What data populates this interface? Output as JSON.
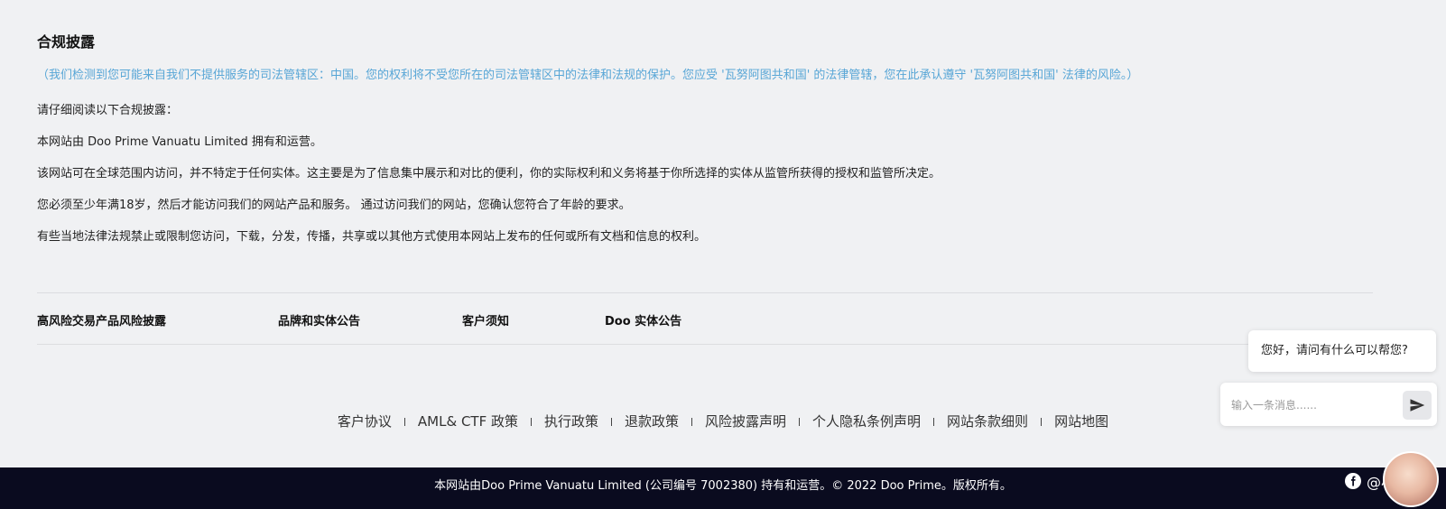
{
  "disclosure": {
    "title": "合规披露",
    "notice": "（我们检测到您可能来自我们不提供服务的司法管辖区：中国。您的权利将不受您所在的司法管辖区中的法律和法规的保护。您应受 '瓦努阿图共和国' 的法律管辖，您在此承认遵守 '瓦努阿图共和国' 法律的风险。）",
    "paragraphs": [
      "请仔细阅读以下合规披露：",
      "本网站由 Doo Prime Vanuatu Limited 拥有和运营。",
      "该网站可在全球范围内访问，并不特定于任何实体。这主要是为了信息集中展示和对比的便利，你的实际权利和义务将基于你所选择的实体从监管所获得的授权和监管所决定。",
      "您必须至少年满18岁，然后才能访问我们的网站产品和服务。 通过访问我们的网站，您确认您符合了年龄的要求。",
      "有些当地法律法规禁止或限制您访问，下载，分发，传播，共享或以其他方式使用本网站上发布的任何或所有文档和信息的权利。"
    ]
  },
  "tabs": [
    {
      "label": "高风险交易产品风险披露"
    },
    {
      "label": "品牌和实体公告"
    },
    {
      "label": "客户须知"
    },
    {
      "label": "Doo 实体公告"
    }
  ],
  "footer_links": [
    "客户协议",
    "AML& CTF 政策",
    "执行政策",
    "退款政策",
    "风险披露声明",
    "个人隐私条例声明",
    "网站条款细则",
    "网站地图"
  ],
  "copyright": "本网站由Doo Prime Vanuatu Limited (公司编号 7002380) 持有和运营。© 2022 Doo Prime。版权所有。",
  "chat": {
    "greeting": "您好，请问有什么可以帮您?",
    "input_placeholder": "输入一条消息......",
    "send_icon": "send-icon"
  },
  "social": {
    "icon": "facebook-icon",
    "handle": "@小呆"
  },
  "colors": {
    "notice_text": "#58a6d6",
    "footer_bar": "#0a0b1f",
    "page_bg": "#f0f1f3"
  }
}
